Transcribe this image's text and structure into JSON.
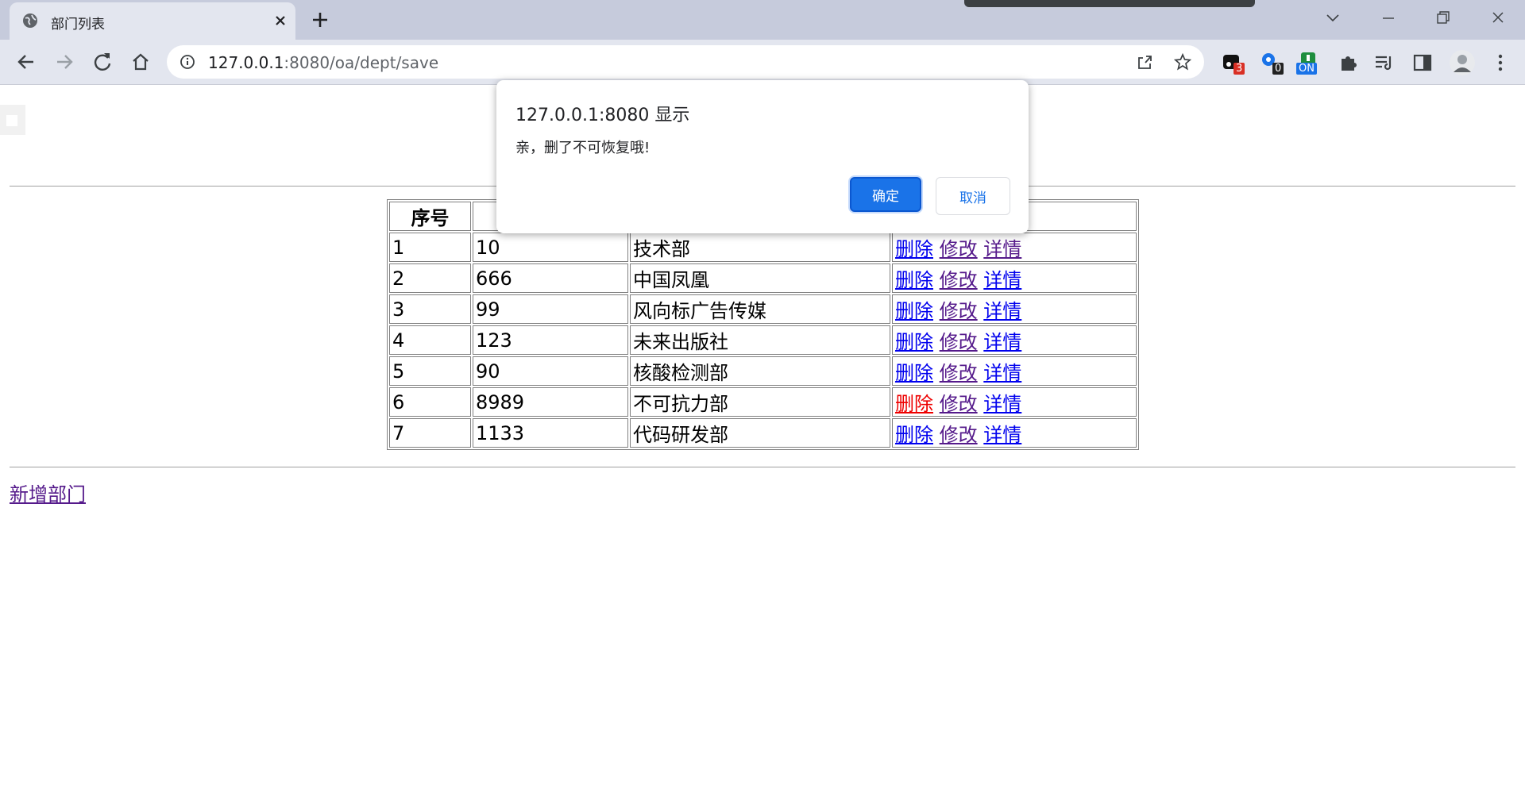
{
  "browser": {
    "tab_title": "部门列表",
    "url_host": "127.0.0.1",
    "url_rest": ":8080/oa/dept/save",
    "extensions": [
      {
        "name": "ext-1",
        "badge": "3"
      },
      {
        "name": "ext-2",
        "badge": "0"
      },
      {
        "name": "ext-3",
        "badge": "ON"
      }
    ]
  },
  "page": {
    "table": {
      "header_index": "序号",
      "rows": [
        {
          "index": "1",
          "deptno": "10",
          "dname": "技术部"
        },
        {
          "index": "2",
          "deptno": "666",
          "dname": "中国凤凰"
        },
        {
          "index": "3",
          "deptno": "99",
          "dname": "风向标广告传媒"
        },
        {
          "index": "4",
          "deptno": "123",
          "dname": "未来出版社"
        },
        {
          "index": "5",
          "deptno": "90",
          "dname": "核酸检测部"
        },
        {
          "index": "6",
          "deptno": "8989",
          "dname": "不可抗力部"
        },
        {
          "index": "7",
          "deptno": "1133",
          "dname": "代码研发部"
        }
      ],
      "actions": {
        "delete": "删除",
        "edit": "修改",
        "detail": "详情"
      }
    },
    "add_link": "新增部门"
  },
  "dialog": {
    "title": "127.0.0.1:8080 显示",
    "message": "亲，删了不可恢复哦!",
    "ok_label": "确定",
    "cancel_label": "取消"
  },
  "colors": {
    "link": "#0000ee",
    "visited_link": "#551a8b",
    "active_link": "#ee0000",
    "dialog_button": "#1a73e8"
  }
}
